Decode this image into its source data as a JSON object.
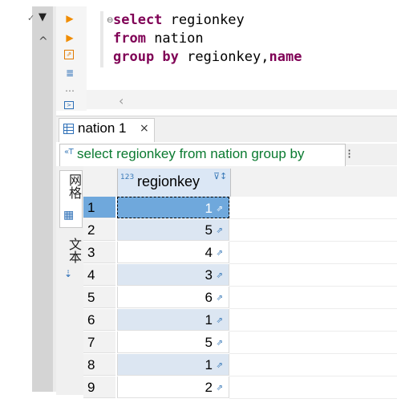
{
  "editor": {
    "lines": [
      [
        {
          "t": "select",
          "k": true
        },
        {
          "t": " regionkey",
          "k": false
        }
      ],
      [
        {
          "t": "from",
          "k": true
        },
        {
          "t": " nation",
          "k": false
        }
      ],
      [
        {
          "t": "group by",
          "k": true
        },
        {
          "t": " regionkey,",
          "k": false
        },
        {
          "t": "name",
          "k": true
        }
      ]
    ]
  },
  "result_tab": {
    "label": "nation 1",
    "close": "×"
  },
  "filter": {
    "text": "select regionkey from nation group by"
  },
  "side_tabs": {
    "grid": "网格",
    "text": "文本"
  },
  "grid": {
    "column": {
      "type_badge": "123",
      "name": "regionkey"
    },
    "rows": [
      {
        "num": "1",
        "value": "1"
      },
      {
        "num": "2",
        "value": "5"
      },
      {
        "num": "3",
        "value": "4"
      },
      {
        "num": "4",
        "value": "3"
      },
      {
        "num": "5",
        "value": "6"
      },
      {
        "num": "6",
        "value": "1"
      },
      {
        "num": "7",
        "value": "5"
      },
      {
        "num": "8",
        "value": "1"
      },
      {
        "num": "9",
        "value": "2"
      }
    ],
    "selected_row": 0
  },
  "icons": {
    "gutter": [
      "chevron-down-icon",
      "chevron-up-icon"
    ],
    "toolbar": [
      "run-icon",
      "run-script-icon",
      "export-icon",
      "format-icon",
      "more-icon",
      "console-icon"
    ]
  },
  "colors": {
    "keyword": "#7f0055",
    "selection": "#6fa8dc",
    "filter_text": "#0a7a30"
  }
}
